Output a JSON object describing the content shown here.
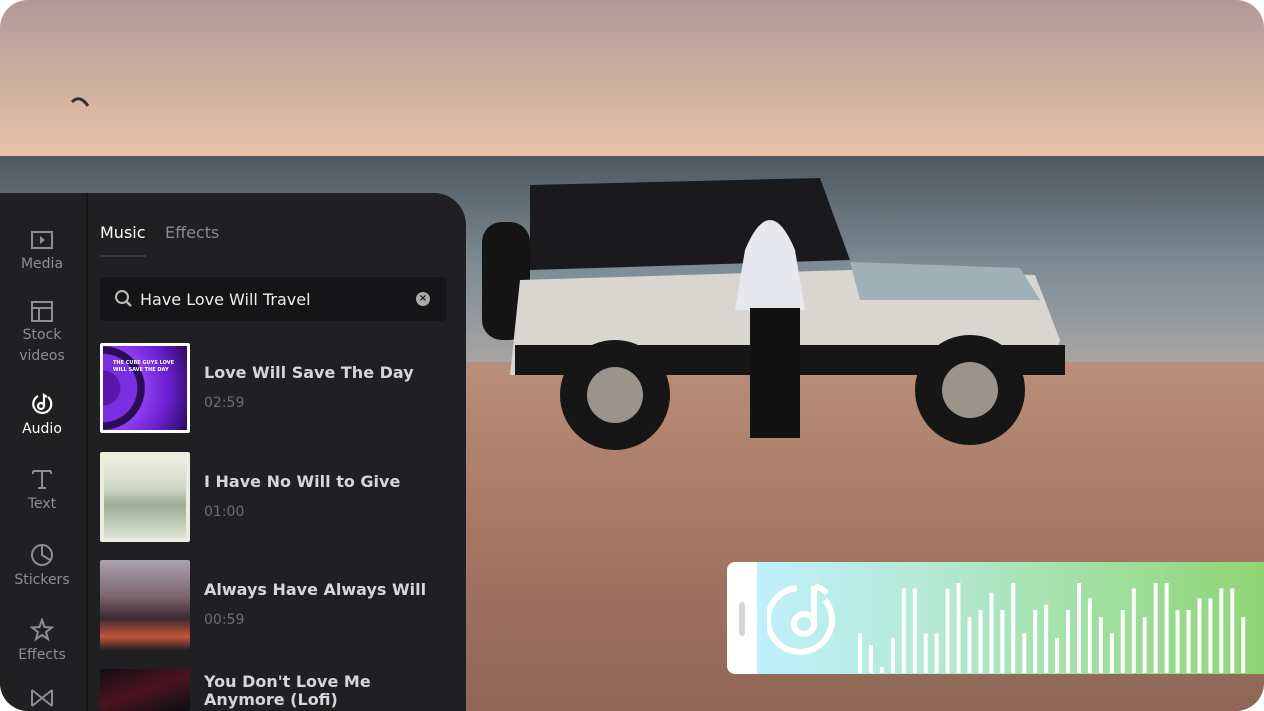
{
  "sidebar": {
    "items": [
      {
        "label": "Media",
        "icon": "media-play-icon"
      },
      {
        "label": "Stock videos",
        "icon": "layout-icon"
      },
      {
        "label": "Audio",
        "icon": "music-note-icon",
        "active": true
      },
      {
        "label": "Text",
        "icon": "text-icon"
      },
      {
        "label": "Stickers",
        "icon": "sticker-icon"
      },
      {
        "label": "Effects",
        "icon": "sparkle-star-icon"
      },
      {
        "label": "",
        "icon": "transitions-icon"
      }
    ]
  },
  "tabs": [
    {
      "label": "Music",
      "active": true
    },
    {
      "label": "Effects"
    }
  ],
  "search": {
    "value": "Have Love Will Travel"
  },
  "songs": [
    {
      "title": "Love Will Save The Day",
      "duration": "02:59",
      "selected": true,
      "cover_text": "THE CUBE GUYS LOVE WILL SAVE THE DAY"
    },
    {
      "title": "I Have No Will to Give",
      "duration": "01:00"
    },
    {
      "title": "Always Have Always Will",
      "duration": "00:59"
    },
    {
      "title": "You Don't Love Me Anymore (Lofi)",
      "duration": ""
    }
  ],
  "audio_clip": {
    "icon": "music-note-icon",
    "gradient": [
      "#bff0fd",
      "#8fd574"
    ],
    "waveform_levels": [
      0.44,
      0.31,
      0.07,
      0.39,
      0.94,
      0.94,
      0.44,
      0.44,
      0.94,
      1.0,
      0.62,
      0.7,
      0.89,
      0.7,
      1.0,
      0.44,
      0.7,
      0.76,
      0.39,
      0.7,
      1.0,
      0.83,
      0.62,
      0.44,
      0.7,
      0.94,
      0.62,
      1.0,
      1.0,
      0.7,
      0.7,
      0.83,
      0.83,
      0.94,
      0.94,
      0.62
    ]
  },
  "colors": {
    "panel": "#202022",
    "accent_selected": "#ffffff"
  }
}
